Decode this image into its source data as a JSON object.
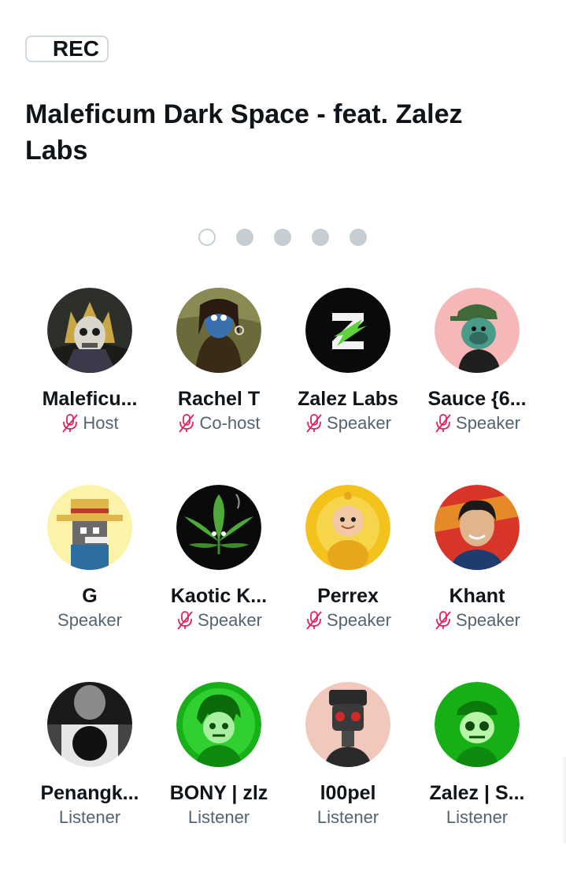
{
  "rec_label": "REC",
  "title": "Maleficum Dark Space -  feat. Zalez Labs",
  "pager": {
    "count": 5,
    "active_index": 0
  },
  "colors": {
    "muted_icon": "#e0245e",
    "role_text": "#536471"
  },
  "participants": [
    {
      "name": "Maleficu...",
      "role": "Host",
      "muted": true,
      "avatar": "skull-crown-icon"
    },
    {
      "name": "Rachel T",
      "role": "Co-host",
      "muted": true,
      "avatar": "mona-lisa-icon"
    },
    {
      "name": "Zalez Labs",
      "role": "Speaker",
      "muted": true,
      "avatar": "z-logo-icon"
    },
    {
      "name": "Sauce {6...",
      "role": "Speaker",
      "muted": true,
      "avatar": "ape-cap-icon"
    },
    {
      "name": "G",
      "role": "Speaker",
      "muted": false,
      "avatar": "pixel-straw-hat-icon"
    },
    {
      "name": "Kaotic K...",
      "role": "Speaker",
      "muted": true,
      "avatar": "leaf-icon"
    },
    {
      "name": "Perrex",
      "role": "Speaker",
      "muted": true,
      "avatar": "teletubby-icon"
    },
    {
      "name": "Khant",
      "role": "Speaker",
      "muted": true,
      "avatar": "person-photo-icon"
    },
    {
      "name": "Penangk...",
      "role": "Listener",
      "muted": false,
      "avatar": "bw-photo-icon"
    },
    {
      "name": "BONY | zlz",
      "role": "Listener",
      "muted": false,
      "avatar": "green-character-icon"
    },
    {
      "name": "l00pel",
      "role": "Listener",
      "muted": false,
      "avatar": "robot-icon"
    },
    {
      "name": "Zalez | S...",
      "role": "Listener",
      "muted": false,
      "avatar": "green-skull-icon"
    }
  ]
}
